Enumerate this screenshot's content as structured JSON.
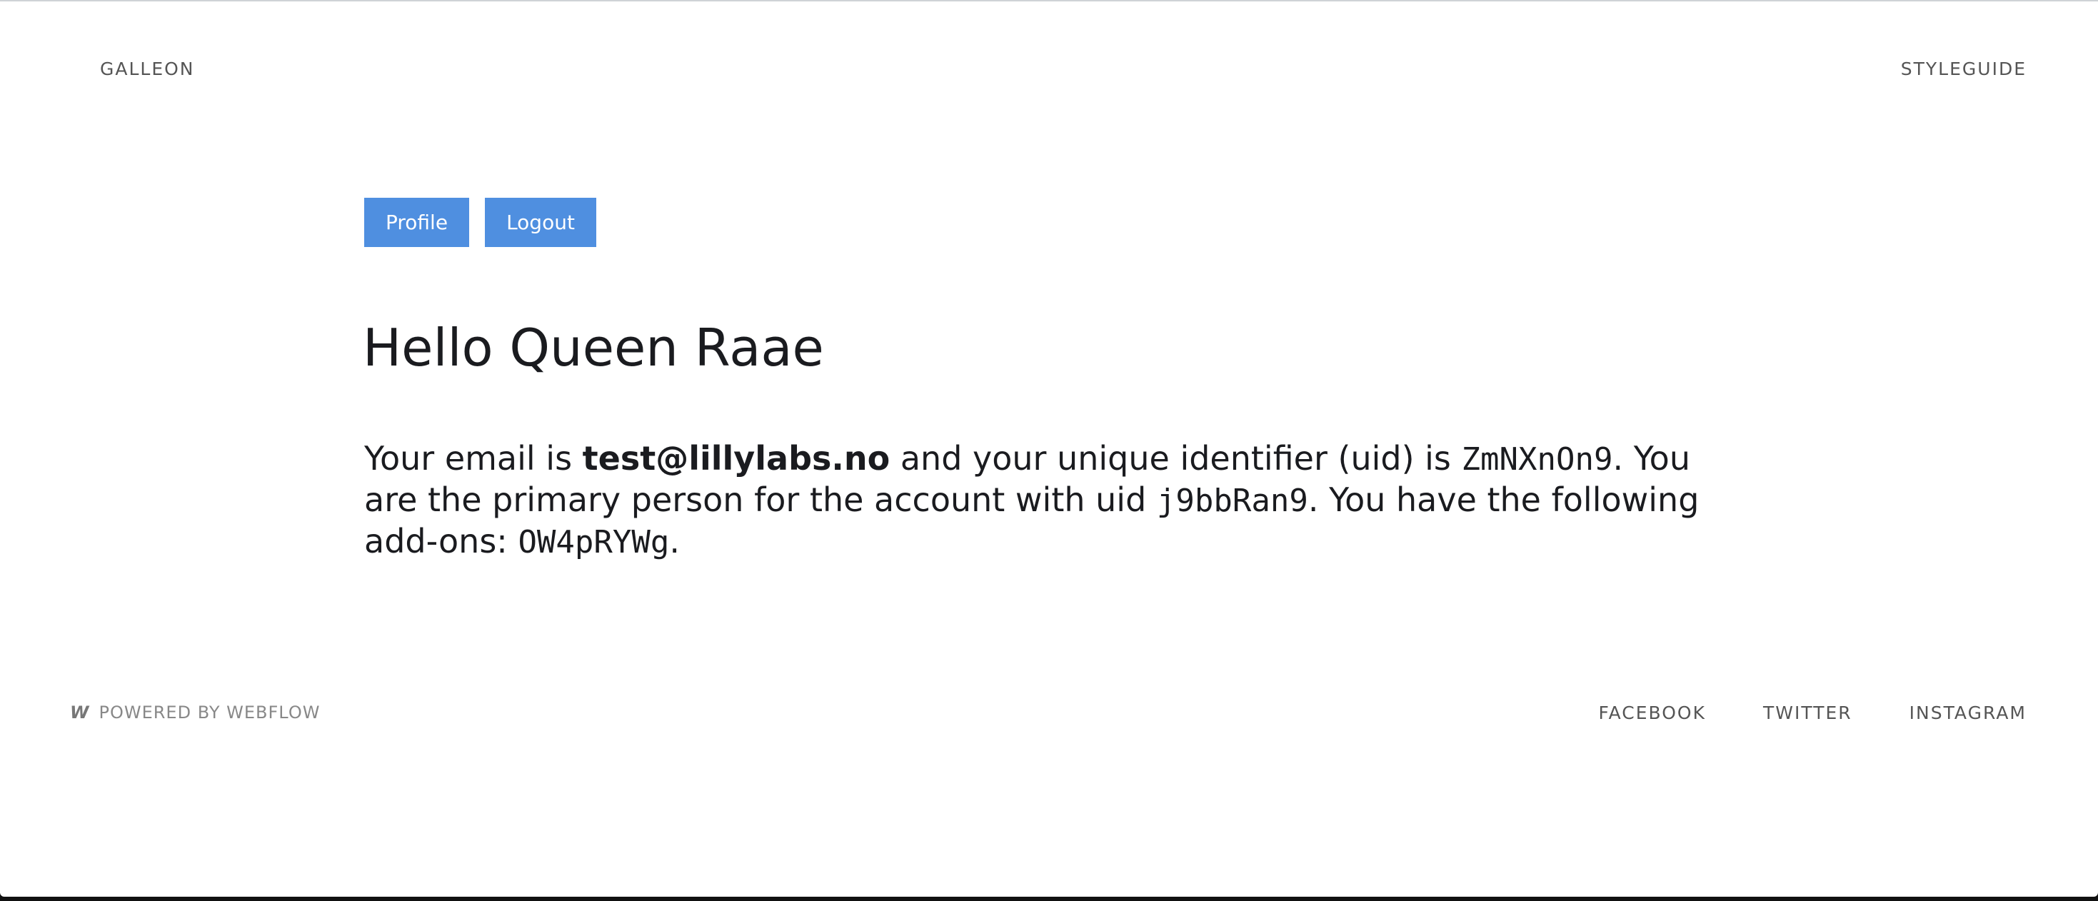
{
  "header": {
    "brand": "GALLEON",
    "styleguide_link": "STYLEGUIDE"
  },
  "actions": {
    "profile_label": "Profile",
    "logout_label": "Logout"
  },
  "main": {
    "greeting": "Hello Queen Raae",
    "email_prefix": "Your email is ",
    "email": "test@lillylabs.no",
    "uid_prefix": " and your unique identifier (uid) is ",
    "uid": "ZmNXnOn9",
    "account_prefix": ". You are the primary person for the account with uid ",
    "account_uid": "j9bbRan9",
    "addons_prefix": ". You have the following add-ons: ",
    "addons": "OW4pRYWg",
    "end": "."
  },
  "footer": {
    "webflow_icon": "webflow-logo-icon",
    "webflow_glyph": "W",
    "powered_by": "POWERED BY WEBFLOW",
    "social": [
      "FACEBOOK",
      "TWITTER",
      "INSTAGRAM"
    ]
  },
  "colors": {
    "button": "#4f8fe0",
    "text": "#1a1b1f",
    "muted": "#555555"
  }
}
